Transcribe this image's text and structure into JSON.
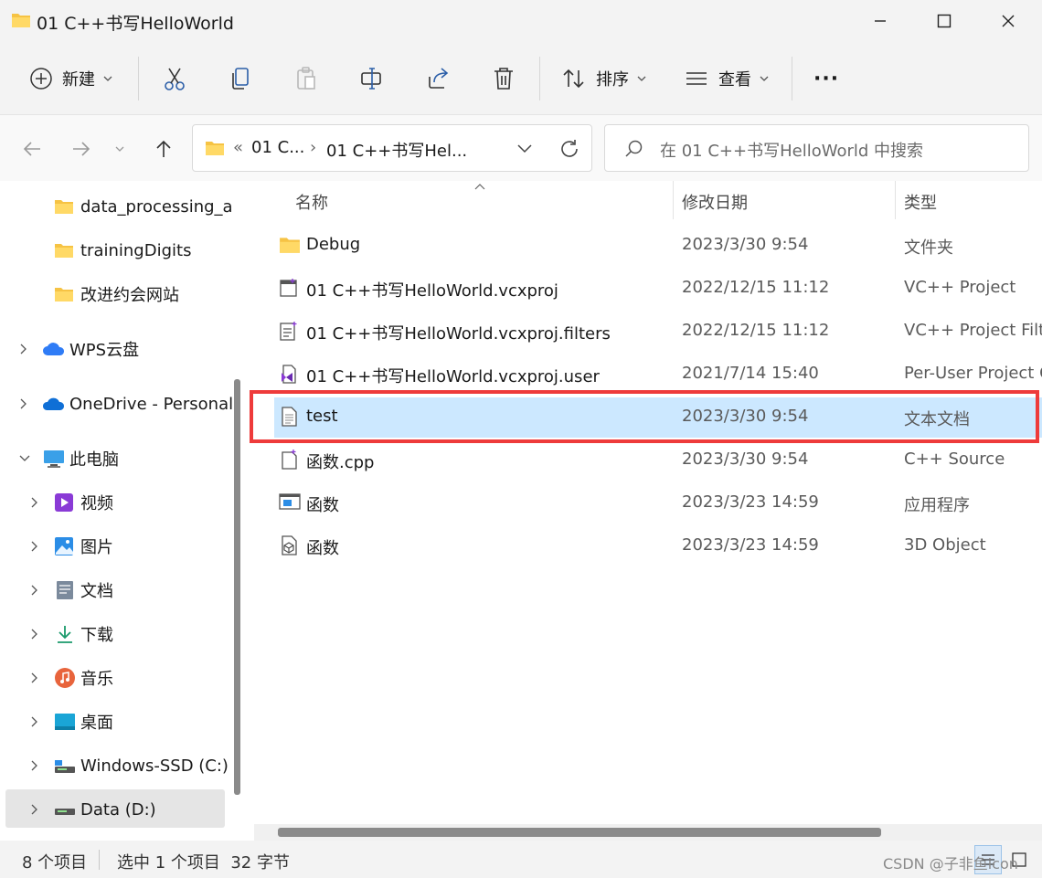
{
  "window": {
    "title": "01 C++书写HelloWorld"
  },
  "toolbar": {
    "new_label": "新建",
    "sort_label": "排序",
    "view_label": "查看",
    "more_label": "···"
  },
  "address": {
    "overflow": "«",
    "crumb1": "01 C...",
    "separator": "›",
    "crumb2": "01 C++书写Hel...",
    "search_placeholder": "在 01 C++书写HelloWorld 中搜索"
  },
  "sidebar": {
    "items": [
      {
        "label": "data_processing_a",
        "icon": "folder-icon"
      },
      {
        "label": "trainingDigits",
        "icon": "folder-icon"
      },
      {
        "label": "改进约会网站",
        "icon": "folder-icon"
      },
      {
        "label": "WPS云盘",
        "icon": "wps-cloud-icon"
      },
      {
        "label": "OneDrive - Personal",
        "icon": "onedrive-icon"
      },
      {
        "label": "此电脑",
        "icon": "computer-icon"
      },
      {
        "label": "视频",
        "icon": "video-icon"
      },
      {
        "label": "图片",
        "icon": "pictures-icon"
      },
      {
        "label": "文档",
        "icon": "documents-icon"
      },
      {
        "label": "下载",
        "icon": "download-icon"
      },
      {
        "label": "音乐",
        "icon": "music-icon"
      },
      {
        "label": "桌面",
        "icon": "desktop-icon"
      },
      {
        "label": "Windows-SSD (C:)",
        "icon": "drive-icon"
      },
      {
        "label": "Data (D:)",
        "icon": "drive-icon"
      }
    ]
  },
  "columns": {
    "name": "名称",
    "date": "修改日期",
    "type": "类型"
  },
  "files": [
    {
      "name": "Debug",
      "date": "2023/3/30 9:54",
      "type": "文件夹",
      "icon": "folder-icon"
    },
    {
      "name": "01 C++书写HelloWorld.vcxproj",
      "date": "2022/12/15 11:12",
      "type": "VC++ Project",
      "icon": "vcxproj-icon"
    },
    {
      "name": "01 C++书写HelloWorld.vcxproj.filters",
      "date": "2022/12/15 11:12",
      "type": "VC++ Project Filte",
      "icon": "filters-icon"
    },
    {
      "name": "01 C++书写HelloWorld.vcxproj.user",
      "date": "2021/7/14 15:40",
      "type": "Per-User Project O",
      "icon": "vs-user-icon"
    },
    {
      "name": "test",
      "date": "2023/3/30 9:54",
      "type": "文本文档",
      "icon": "text-file-icon",
      "selected": true
    },
    {
      "name": "函数.cpp",
      "date": "2023/3/30 9:54",
      "type": "C++ Source",
      "icon": "cpp-file-icon"
    },
    {
      "name": "函数",
      "date": "2023/3/23 14:59",
      "type": "应用程序",
      "icon": "exe-icon"
    },
    {
      "name": "函数",
      "date": "2023/3/23 14:59",
      "type": "3D Object",
      "icon": "3d-object-icon"
    }
  ],
  "status": {
    "item_count": "8 个项目",
    "selection": "选中 1 个项目  32 字节"
  },
  "watermark": "CSDN @子非鱼icon",
  "colors": {
    "selection": "#cce8ff",
    "highlight_border": "#ee3b3b",
    "folder": "#f6c344",
    "accent": "#0067c0"
  }
}
